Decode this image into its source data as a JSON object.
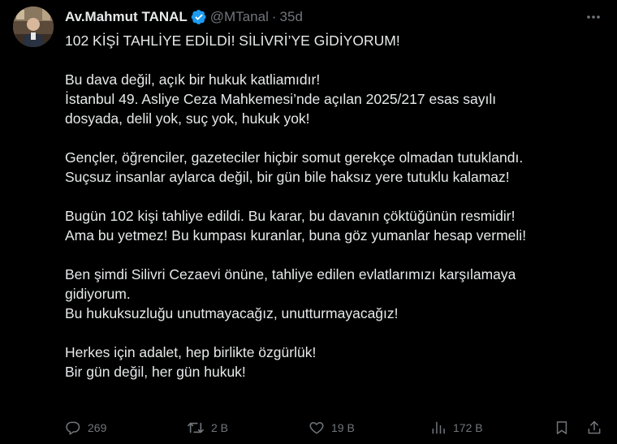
{
  "author": {
    "display_name": "Av.Mahmut TANAL",
    "handle": "@MTanal",
    "separator": "·",
    "time": "35d",
    "verified": true
  },
  "tweet": {
    "paragraphs": [
      [
        "102 KİŞİ TAHLİYE EDİLDİ! SİLİVRİ’YE GİDİYORUM!"
      ],
      [
        "Bu dava değil, açık bir hukuk katliamıdır!",
        "İstanbul 49. Asliye Ceza Mahkemesi’nde açılan 2025/217 esas sayılı",
        "dosyada, delil yok, suç yok, hukuk yok!"
      ],
      [
        "Gençler, öğrenciler, gazeteciler hiçbir somut gerekçe olmadan tutuklandı.",
        "Suçsuz insanlar aylarca değil, bir gün bile haksız yere tutuklu kalamaz!"
      ],
      [
        "Bugün 102 kişi tahliye edildi. Bu karar, bu davanın çöktüğünün resmidir!",
        "Ama bu yetmez! Bu kumpası kuranlar, buna göz yumanlar hesap vermeli!"
      ],
      [
        "Ben şimdi Silivri Cezaevi önüne, tahliye edilen evlatlarımızı karşılamaya",
        "gidiyorum.",
        "Bu hukuksuzluğu unutmayacağız, unutturmayacağız!"
      ],
      [
        "Herkes için adalet, hep birlikte özgürlük!",
        "Bir gün değil, her gün hukuk!"
      ]
    ]
  },
  "actions": {
    "reply": {
      "icon": "reply-icon",
      "count": "269"
    },
    "repost": {
      "icon": "repost-icon",
      "count": "2 B"
    },
    "like": {
      "icon": "heart-icon",
      "count": "19 B"
    },
    "views": {
      "icon": "views-icon",
      "count": "172 B"
    },
    "bookmark": {
      "icon": "bookmark-icon"
    },
    "share": {
      "icon": "share-icon"
    }
  },
  "colors": {
    "background": "#000000",
    "text": "#e7e9ea",
    "muted": "#71767b",
    "verified": "#1d9bf0"
  }
}
